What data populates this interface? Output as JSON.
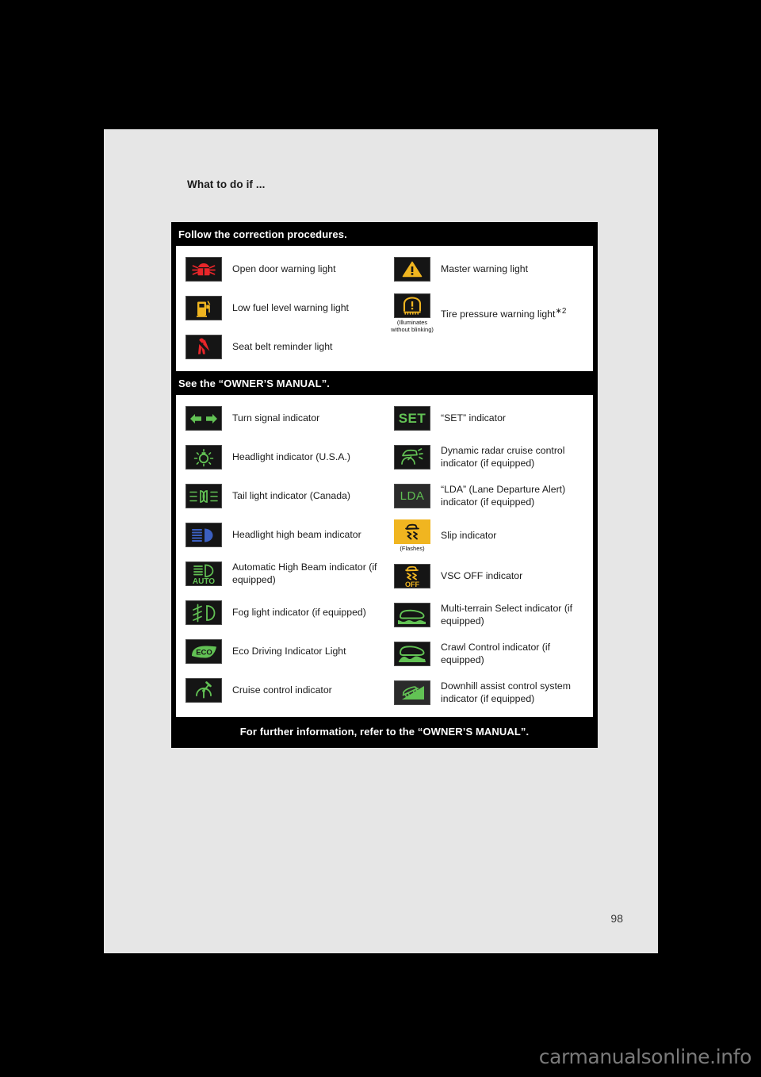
{
  "page": {
    "heading": "What to do if ...",
    "number": "98"
  },
  "watermark": "carmanualsonline.info",
  "table": {
    "footer": "For further information, refer to the “OWNER’S MANUAL”.",
    "sections": [
      {
        "title": "Follow the correction procedures.",
        "left_items": [
          {
            "icon": "open-door-warning-icon",
            "label": "Open door warning light",
            "note": ""
          },
          {
            "icon": "low-fuel-warning-icon",
            "label": "Low fuel level warning light",
            "note": ""
          },
          {
            "icon": "seat-belt-reminder-icon",
            "label": "Seat belt reminder light",
            "note": ""
          }
        ],
        "right_items": [
          {
            "icon": "master-warning-icon",
            "label": "Master warning light",
            "note": ""
          },
          {
            "icon": "tire-pressure-warning-icon",
            "label": "Tire pressure warning light",
            "sup": "∗2",
            "note": "(Illuminates without blinking)"
          }
        ]
      },
      {
        "title": "See the “OWNER’S MANUAL”.",
        "left_items": [
          {
            "icon": "turn-signal-icon",
            "label": "Turn signal indicator",
            "note": ""
          },
          {
            "icon": "headlight-icon",
            "label": "Headlight indicator (U.S.A.)",
            "note": ""
          },
          {
            "icon": "tail-light-icon",
            "label": "Tail light indicator (Canada)",
            "note": ""
          },
          {
            "icon": "high-beam-icon",
            "label": "Headlight high beam indicator",
            "note": ""
          },
          {
            "icon": "auto-high-beam-icon",
            "label": "Automatic High Beam indicator (if equipped)",
            "note": ""
          },
          {
            "icon": "fog-light-icon",
            "label": "Fog light indicator (if equipped)",
            "note": ""
          },
          {
            "icon": "eco-driving-icon",
            "label": "Eco Driving Indicator Light",
            "note": ""
          },
          {
            "icon": "cruise-control-icon",
            "label": "Cruise control indicator",
            "note": ""
          }
        ],
        "right_items": [
          {
            "icon": "set-indicator-icon",
            "label": "“SET” indicator",
            "note": ""
          },
          {
            "icon": "dynamic-radar-cruise-icon",
            "label": "Dynamic radar cruise control indicator (if equipped)",
            "note": ""
          },
          {
            "icon": "lda-indicator-icon",
            "label": "“LDA” (Lane Departure Alert) indicator (if equipped)",
            "note": ""
          },
          {
            "icon": "slip-indicator-icon",
            "label": "Slip indicator",
            "note": "(Flashes)"
          },
          {
            "icon": "vsc-off-icon",
            "label": "VSC OFF indicator",
            "note": ""
          },
          {
            "icon": "multi-terrain-select-icon",
            "label": "Multi-terrain Select indicator (if equipped)",
            "note": ""
          },
          {
            "icon": "crawl-control-icon",
            "label": "Crawl Control indicator (if equipped)",
            "note": ""
          },
          {
            "icon": "downhill-assist-icon",
            "label": "Downhill assist control system indicator (if equipped)",
            "note": ""
          }
        ]
      }
    ]
  },
  "colors": {
    "warning_red": "#e8262a",
    "warning_amber": "#f0b520",
    "indicator_green": "#62c254",
    "high_beam_blue": "#3b5fc0",
    "icon_background": "#151515",
    "page_background": "#e6e6e6",
    "table_background": "#000000"
  }
}
